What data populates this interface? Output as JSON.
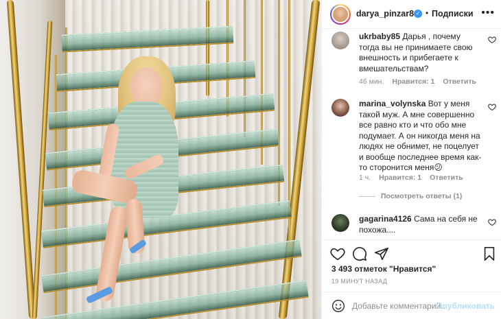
{
  "post": {
    "username": "darya_pinzar86",
    "verified_badge": "✓",
    "separator": "•",
    "follow_label": "Подписки",
    "more_label": "•••",
    "verified_color": "#3897f0"
  },
  "comments": [
    {
      "username": "ukrbaby85",
      "text": "Дарья , почему тогда вы не принимаете свою внешность и прибегаете к вмешательствам?",
      "time": "46 мин.",
      "likes": "Нравится: 1",
      "reply": "Ответить"
    },
    {
      "username": "marina_volynska",
      "text": "Вот у меня такой муж. А мне совершенно все равно кто и что обо мне подумает. А он никогда меня на людях не обнимет, не поцелует и вообще последнее время как-то сторонится меня😕",
      "time": "1 ч.",
      "likes": "Нравится: 1",
      "reply": "Ответить",
      "view_replies": "Посмотреть ответы (1)"
    },
    {
      "username": "gagarina4126",
      "text": "Сама на себя не похожа....",
      "time": "",
      "likes": "",
      "reply": ""
    }
  ],
  "actions": {
    "icons": [
      "heart-icon",
      "comment-icon",
      "share-icon",
      "bookmark-icon"
    ]
  },
  "likes_text": "3 493 отметок \"Нравится\"",
  "post_time": "19 МИНУТ НАЗАД",
  "add_comment": {
    "placeholder": "Добавьте комментарий...",
    "publish_label": "Опубликовать",
    "publish_color": "#b2dffc"
  }
}
